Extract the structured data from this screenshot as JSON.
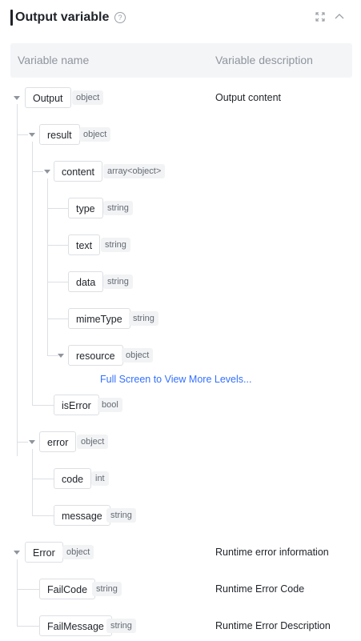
{
  "panel": {
    "title": "Output variable",
    "help_glyph": "?",
    "fullscreen_icon": "expand-icon",
    "collapse_icon": "chevron-up-icon"
  },
  "columns": {
    "name": "Variable name",
    "description": "Variable description"
  },
  "rows": [
    {
      "name": "Output",
      "type": "object",
      "description": "Output content"
    },
    {
      "name": "result",
      "type": "object",
      "description": ""
    },
    {
      "name": "content",
      "type": "array<object>",
      "description": ""
    },
    {
      "name": "type",
      "type": "string",
      "description": ""
    },
    {
      "name": "text",
      "type": "string",
      "description": ""
    },
    {
      "name": "data",
      "type": "string",
      "description": ""
    },
    {
      "name": "mimeType",
      "type": "string",
      "description": ""
    },
    {
      "name": "resource",
      "type": "object",
      "description": ""
    },
    {
      "name": "isError",
      "type": "bool",
      "description": ""
    },
    {
      "name": "error",
      "type": "object",
      "description": ""
    },
    {
      "name": "code",
      "type": "int",
      "description": ""
    },
    {
      "name": "message",
      "type": "string",
      "description": ""
    },
    {
      "name": "Error",
      "type": "object",
      "description": "Runtime error information"
    },
    {
      "name": "FailCode",
      "type": "string",
      "description": "Runtime Error Code"
    },
    {
      "name": "FailMessage",
      "type": "string",
      "description": "Runtime Error Description"
    }
  ],
  "more_levels_link": "Full Screen to View More Levels..."
}
